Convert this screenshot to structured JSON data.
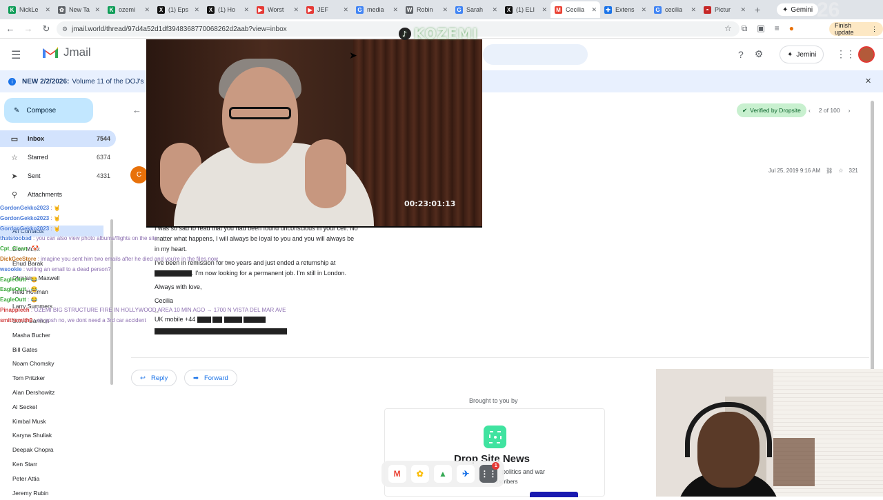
{
  "browser": {
    "tabs": [
      {
        "title": "NickLe",
        "color": "#0f9d58",
        "letter": "K"
      },
      {
        "title": "New Ta",
        "color": "#5f6368",
        "letter": "✿"
      },
      {
        "title": "ozemi",
        "color": "#0f9d58",
        "letter": "K"
      },
      {
        "title": "(1) Eps",
        "color": "#111111",
        "letter": "X"
      },
      {
        "title": "(1) Ho",
        "color": "#111111",
        "letter": "X"
      },
      {
        "title": "Worst",
        "color": "#e53935",
        "letter": "▶"
      },
      {
        "title": "JEF",
        "color": "#e53935",
        "letter": "▶"
      },
      {
        "title": "media",
        "color": "#4285f4",
        "letter": "G"
      },
      {
        "title": "Robin",
        "color": "#5f6368",
        "letter": "W"
      },
      {
        "title": "Sarah",
        "color": "#4285f4",
        "letter": "G"
      },
      {
        "title": "(1) ELI",
        "color": "#111111",
        "letter": "X"
      },
      {
        "title": "Cecilia",
        "color": "#ea4335",
        "letter": "M"
      },
      {
        "title": "Extens",
        "color": "#1a73e8",
        "letter": "✚"
      },
      {
        "title": "cecilia",
        "color": "#4285f4",
        "letter": "G"
      },
      {
        "title": "Pictur",
        "color": "#c62828",
        "letter": "◓"
      }
    ],
    "gemini_label": "Gemini",
    "window_number": "26",
    "url": "jmail.world/thread/97d4a52d1df3948368770068262d2aab?view=inbox",
    "finish_update_label": "Finish update"
  },
  "app": {
    "name": "Jmail",
    "jemini_label": "Jemini"
  },
  "banner": {
    "bold": "NEW 2/2/2026:",
    "text": "Volume 11 of the DOJ's 1 m"
  },
  "sidebar": {
    "compose_label": "Compose",
    "nav": [
      {
        "label": "Inbox",
        "count": "7544",
        "icon": "inbox-icon",
        "glyph": "▭"
      },
      {
        "label": "Starred",
        "count": "6374",
        "icon": "star-icon",
        "glyph": "☆"
      },
      {
        "label": "Sent",
        "count": "4331",
        "icon": "send-icon",
        "glyph": "➤"
      },
      {
        "label": "Attachments",
        "count": "",
        "icon": "paperclip-icon",
        "glyph": "⚲"
      }
    ],
    "all_contacts": "All Contacts",
    "contacts": [
      "Elon Musk",
      "Ehud Barak",
      "Ghislaine Maxwell",
      "Reid Hoffman",
      "Larry Summers",
      "Steve Bannon",
      "Masha Bucher",
      "Bill Gates",
      "Noam Chomsky",
      "Tom Pritzker",
      "Alan Dershowitz",
      "Al Seckel",
      "Kimbal Musk",
      "Karyna Shuliak",
      "Deepak Chopra",
      "Ken Starr",
      "Peter Attia",
      "Jeremy Rubin"
    ]
  },
  "chat": [
    {
      "user": "GordonGekko2023",
      "msg": ": 🤘",
      "cls": ""
    },
    {
      "user": "GordonGekko2023",
      "msg": ": 🤘",
      "cls": ""
    },
    {
      "user": "GordonGekko2023",
      "msg": ": 🤘",
      "cls": ""
    },
    {
      "user": "thatstoobad",
      "msg": ": you can also view photo albums/flights on the site",
      "cls": ""
    },
    {
      "user": "Cpt_Clean",
      "msg": ": 🤡",
      "cls": "g"
    },
    {
      "user": "DickGeeStore",
      "msg": ": imagine you sent him two emails after he died and you're in the files now",
      "cls": "o"
    },
    {
      "user": "wsookie",
      "msg": ": writing an email to a dead person?",
      "cls": ""
    },
    {
      "user": "EagleOutt",
      "msg": ": 😂",
      "cls": "g"
    },
    {
      "user": "EagleOutt",
      "msg": ": 😂",
      "cls": "g"
    },
    {
      "user": "EagleOutt",
      "msg": ": 😂",
      "cls": "g"
    },
    {
      "user": "Pinappleeh",
      "msg": ": OZEMI BIG STRUCTURE FIRE IN HOLLYWOOD AREA 10 MIN AGO → 1700 N VISTA DEL MAR AVE",
      "cls": "r"
    },
    {
      "user": "smithsmith0",
      "msg": ": oh gosh no, we dont need a 3rd car accident",
      "cls": "r"
    }
  ],
  "thread": {
    "verified_label": "Verified by Dropsite",
    "pager": "2 of 100",
    "sender_initial": "C",
    "date": "Jul 25, 2019 9:16 AM",
    "star_count": "321",
    "body": {
      "line1": "I was so sad to read that you had been found unconscious in your cell. No",
      "line2": "matter what happens, I will always be loyal to you and you will always be",
      "line3": "in my heart.",
      "line4": "I've been in remission for two years and just ended a returnship at",
      "line5": ". I'm now looking for a permanent job. I'm still in London.",
      "sign1": "Always with love,",
      "sign2": "Cecilia",
      "dashes": "--",
      "phone_label": "UK mobile +44"
    },
    "reply_label": "Reply",
    "forward_label": "Forward",
    "brought_by": "Brought to you by",
    "drop_title": "Drop Site News",
    "drop_sub": "politics and war",
    "drop_sub2": "bscribers"
  },
  "overlay": {
    "watermark": "KOZEMI",
    "timecode": "00:23:01:13"
  },
  "dock": {
    "badge": "1"
  }
}
